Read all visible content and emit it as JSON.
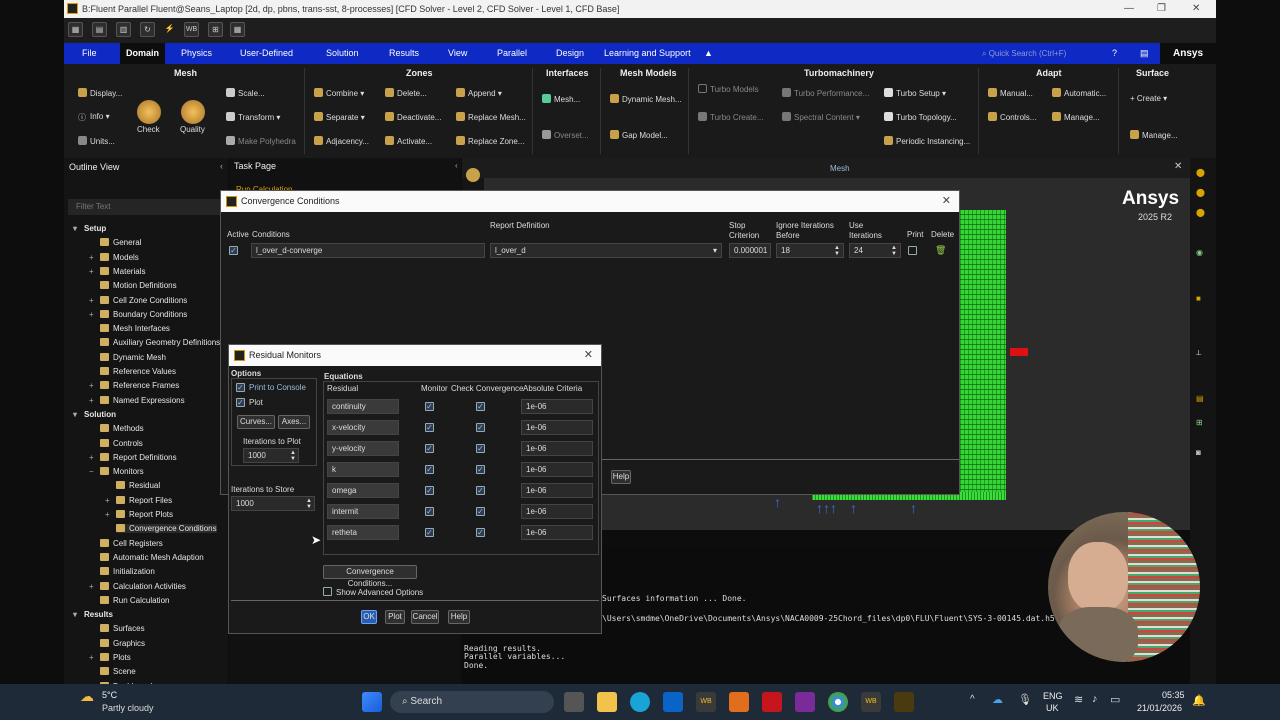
{
  "window": {
    "title": "B:Fluent Parallel Fluent@Seans_Laptop  [2d, dp, pbns, trans-sst, 8-processes] [CFD Solver - Level 2, CFD Solver - Level 1, CFD Base]"
  },
  "menu": {
    "tabs": [
      "File",
      "Domain",
      "Physics",
      "User-Defined",
      "Solution",
      "Results",
      "View",
      "Parallel",
      "Design",
      "Learning and Support"
    ],
    "search_placeholder": "Quick Search (Ctrl+F)",
    "brand": "Ansys"
  },
  "ribbon": {
    "groups": {
      "mesh": "Mesh",
      "zones": "Zones",
      "interfaces": "Interfaces",
      "mesh_models": "Mesh Models",
      "turbomachinery": "Turbomachinery",
      "adapt": "Adapt",
      "surface": "Surface"
    },
    "mesh": {
      "display": "Display...",
      "info": "Info",
      "units": "Units...",
      "check": "Check",
      "quality": "Quality",
      "scale": "Scale...",
      "transform": "Transform",
      "make_poly": "Make Polyhedra"
    },
    "zones": {
      "combine": "Combine",
      "separate": "Separate",
      "adjacency": "Adjacency...",
      "delete": "Delete...",
      "deactivate": "Deactivate...",
      "activate": "Activate...",
      "append": "Append",
      "replace_mesh": "Replace Mesh...",
      "replace_zone": "Replace Zone..."
    },
    "interfaces": {
      "mesh": "Mesh...",
      "overset": "Overset..."
    },
    "mesh_models": {
      "dynamic": "Dynamic Mesh...",
      "gap": "Gap Model..."
    },
    "turbo": {
      "models": "Turbo Models",
      "create": "Turbo Create...",
      "performance": "Turbo Performance...",
      "spectral": "Spectral Content",
      "setup": "Turbo Setup",
      "topology": "Turbo Topology...",
      "periodic": "Periodic Instancing..."
    },
    "adapt": {
      "manual": "Manual...",
      "automatic": "Automatic...",
      "controls": "Controls...",
      "manage": "Manage..."
    },
    "surface": {
      "create": "Create",
      "manage": "Manage..."
    }
  },
  "outline": {
    "title": "Outline View",
    "filter_placeholder": "Filter Text",
    "items": [
      "Setup",
      "General",
      "Models",
      "Materials",
      "Motion Definitions",
      "Cell Zone Conditions",
      "Boundary Conditions",
      "Mesh Interfaces",
      "Auxiliary Geometry Definitions",
      "Dynamic Mesh",
      "Reference Values",
      "Reference Frames",
      "Named Expressions",
      "Solution",
      "Methods",
      "Controls",
      "Report Definitions",
      "Monitors",
      "Residual",
      "Report Files",
      "Report Plots",
      "Convergence Conditions",
      "Cell Registers",
      "Automatic Mesh Adaption",
      "Initialization",
      "Calculation Activities",
      "Run Calculation",
      "Results",
      "Surfaces",
      "Graphics",
      "Plots",
      "Scene",
      "Dashboard"
    ]
  },
  "task_page": {
    "title": "Task Page",
    "sub": "Run Calculation"
  },
  "graphics": {
    "tab": "Mesh",
    "logo": "Ansys",
    "version": "2025 R2"
  },
  "convergence": {
    "title": "Convergence Conditions",
    "headers": {
      "active": "Active",
      "conditions": "Conditions",
      "report": "Report Definition",
      "stop": "Stop Criterion",
      "ignore": "Ignore Iterations Before",
      "use": "Use Iterations",
      "print": "Print",
      "delete": "Delete"
    },
    "row": {
      "condition": "l_over_d-converge",
      "report": "l_over_d",
      "stop": "0.000001",
      "ignore": "18",
      "use": "24"
    },
    "help": "Help"
  },
  "residual": {
    "title": "Residual Monitors",
    "options": {
      "title": "Options",
      "print": "Print to Console",
      "plot": "Plot",
      "curves": "Curves...",
      "axes": "Axes...",
      "iter_plot_label": "Iterations to Plot",
      "iter_plot": "1000",
      "iter_store_label": "Iterations to Store",
      "iter_store": "1000"
    },
    "equations": {
      "title": "Equations",
      "h_residual": "Residual",
      "h_monitor": "Monitor",
      "h_check": "Check Convergence",
      "h_abs": "Absolute Criteria",
      "rows": [
        {
          "name": "continuity",
          "crit": "1e-06"
        },
        {
          "name": "x-velocity",
          "crit": "1e-06"
        },
        {
          "name": "y-velocity",
          "crit": "1e-06"
        },
        {
          "name": "k",
          "crit": "1e-06"
        },
        {
          "name": "omega",
          "crit": "1e-06"
        },
        {
          "name": "intermit",
          "crit": "1e-06"
        },
        {
          "name": "retheta",
          "crit": "1e-06"
        }
      ]
    },
    "conv_button": "Convergence Conditions...",
    "advanced": "Show Advanced Options",
    "buttons": {
      "ok": "OK",
      "plot": "Plot",
      "cancel": "Cancel",
      "help": "Help"
    }
  },
  "console": {
    "lines": [
      "Surfaces information ... Done.",
      "\\Users\\smdme\\OneDrive\\Documents\\Ansys\\NACA0009-25Chord_files\\dp0\\FLU\\Fluent\\SYS-3-00145.dat.h5",
      "",
      "  Reading results.",
      "Parallel variables...",
      "Done."
    ]
  },
  "taskbar": {
    "weather_temp": "5°C",
    "weather_desc": "Partly cloudy",
    "search": "Search",
    "lang": "ENG",
    "region": "UK",
    "time": "05:35",
    "date": "21/01/2026"
  }
}
